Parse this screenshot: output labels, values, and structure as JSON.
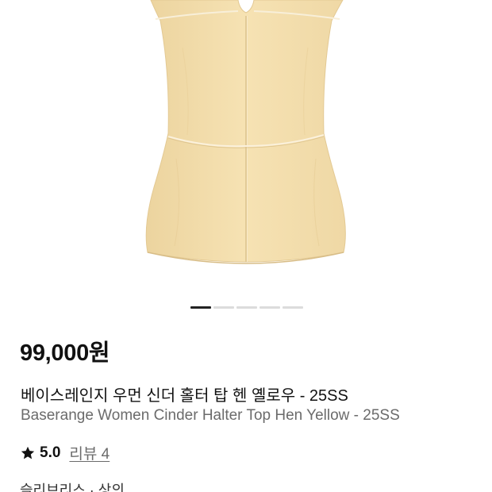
{
  "product": {
    "price": "99,000원",
    "title_ko": "베이스레인지 우먼 신더 홀터 탑 헨 옐로우 - 25SS",
    "title_en": "Baserange Women Cinder Halter Top Hen Yellow - 25SS",
    "rating": "5.0",
    "review_label": "리뷰 4",
    "category": "슬리브리스 · 상의"
  },
  "gallery": {
    "image_count": 5,
    "active_index": 0,
    "garment_color": "#f4dfae"
  },
  "icons": {
    "rating": "star-icon"
  }
}
